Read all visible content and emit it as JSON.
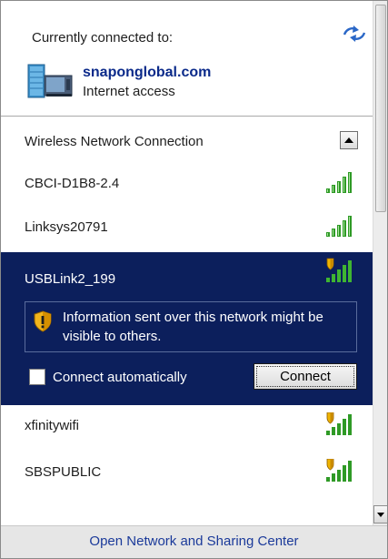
{
  "header": {
    "title": "Currently connected to:",
    "refresh_icon": "refresh-icon",
    "connection": {
      "name": "snaponglobal.com",
      "status": "Internet access",
      "icon": "domain-network-icon"
    }
  },
  "section": {
    "title": "Wireless Network Connection",
    "collapse_icon": "collapse-up-arrow-icon"
  },
  "networks": [
    {
      "ssid": "CBCI-D1B8-2.4",
      "secured": true,
      "signal_bars": 5
    },
    {
      "ssid": "Linksys20791",
      "secured": true,
      "signal_bars": 5
    },
    {
      "ssid": "USBLink2_199",
      "secured": false,
      "signal_bars": 5,
      "selected": true,
      "warning": "Information sent over this network might be visible to others.",
      "connect_automatically_label": "Connect automatically",
      "connect_automatically_checked": false,
      "connect_button_label": "Connect"
    },
    {
      "ssid": "xfinitywifi",
      "secured": false,
      "signal_bars": 5
    },
    {
      "ssid": "SBSPUBLIC",
      "secured": false,
      "signal_bars": 5
    }
  ],
  "footer": {
    "link": "Open Network and Sharing Center"
  },
  "colors": {
    "selected_background": "#0c1f5c",
    "link": "#1b3a9a",
    "connection_name": "#0b2a8a",
    "signal_green": "#2f9a26",
    "shield_yellow": "#f0b400",
    "footer_background": "#e6e6e6"
  }
}
